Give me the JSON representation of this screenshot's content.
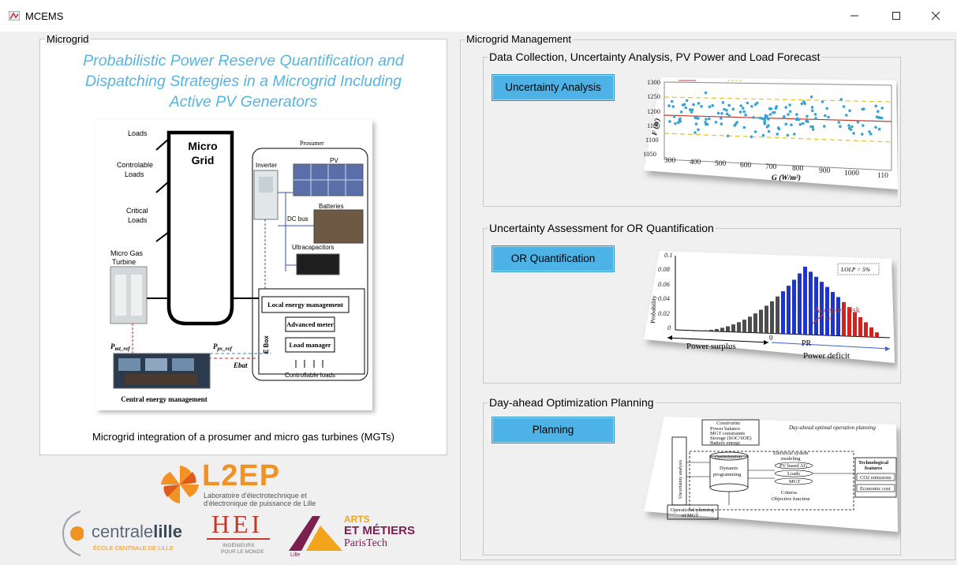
{
  "window": {
    "title": "MCEMS"
  },
  "left": {
    "legend": "Microgrid",
    "title_line1": "Probabilistic Power Reserve Quantification and",
    "title_line2": "Dispatching Strategies in a Microgrid Including",
    "title_line3": "Active PV Generators",
    "caption": "Microgrid integration of a prosumer and micro gas turbines (MGTs)",
    "diagram": {
      "loads": "Loads",
      "controlable1": "Controlable",
      "controlable2": "Loads",
      "critical1": "Critical",
      "critical2": "Loads",
      "mgt1": "Micro Gas",
      "mgt2": "Turbine",
      "micro": "Micro",
      "grid": "Grid",
      "prosumer": "Prosumer",
      "inverter": "Inverter",
      "pv": "PV",
      "batteries": "Batteries",
      "dcbus": "DC bus",
      "ultracap": "Ultracapacitors",
      "lem": "Local energy management",
      "meter": "Advanced meter",
      "loadmgr": "Load manager",
      "ebox": "E Box",
      "ctrl_loads": "Controllable loads",
      "pmt": "P",
      "pmt_sub": "mt_ref",
      "ppv": "P",
      "ppv_sub": "pv_ref",
      "ebat": "Ebat",
      "cem": "Central energy management"
    }
  },
  "logos": {
    "l2ep": "L2EP",
    "l2ep_sub1": "Laboratoire d'électrotechnique et",
    "l2ep_sub2": "d'électronique de puissance de Lille",
    "centrale_a": "centrale",
    "centrale_b": "lille",
    "centrale_sub": "ÉCOLE CENTRALE DE LILLE",
    "hei": "HEI",
    "hei_sub1": "INGÉNIEURS",
    "hei_sub2": "POUR LE MONDE",
    "am1": "ARTS",
    "am2": "ET MÉTIERS",
    "am3": "ParisTech",
    "am_lille": "Lille"
  },
  "right": {
    "legend": "Microgrid Management",
    "s1": {
      "legend": "Data Collection, Uncertainty Analysis, PV Power and Load Forecast",
      "button": "Uncertainty Analysis",
      "ylabel": "F (W)",
      "xlabel": "G (W/m²)",
      "yticks": [
        "1300",
        "1250",
        "1200",
        "1150",
        "1100",
        "1050"
      ],
      "xticks": [
        "300",
        "400",
        "500",
        "600",
        "700",
        "800",
        "900",
        "1000",
        "110"
      ]
    },
    "s2": {
      "legend": "Uncertainty Assessment for OR Quantification",
      "button": "OR Quantification",
      "ylabel": "Probability",
      "yticks": [
        "0.1",
        "0.08",
        "0.06",
        "0.04",
        "0.02",
        "0"
      ],
      "lolp": "LOLP = 5%",
      "accepted": "Accepted risk",
      "pct": "5%",
      "surplus": "Power surplus",
      "zero": "0",
      "pr": "PR",
      "deficit": "Power deficit"
    },
    "s3": {
      "legend": "Day-ahead Optimization Planning",
      "button": "Planning",
      "title": "Day-ahead optimal operation planning",
      "constraints": "Constraints",
      "c1": "Power balance",
      "c2": "MGT constraints",
      "c3": "Storage (SOC/SOE)",
      "c4": "Battery energy",
      "optim": "Optimization",
      "dyn": "Dynamic",
      "prog": "programming",
      "elec1": "Electrical system",
      "elec2": "modeling",
      "pvbased": "PV based AG",
      "loads": "Loads",
      "mgt": "MGT",
      "crit": "Criteria",
      "obj": "Objective function",
      "tech1": "Technological",
      "tech2": "features",
      "co2": "CO2 emissions",
      "econ": "Economic cost",
      "oper1": "Operational planning",
      "oper2": "of MGT",
      "side": "Uncertainty analysis"
    }
  }
}
